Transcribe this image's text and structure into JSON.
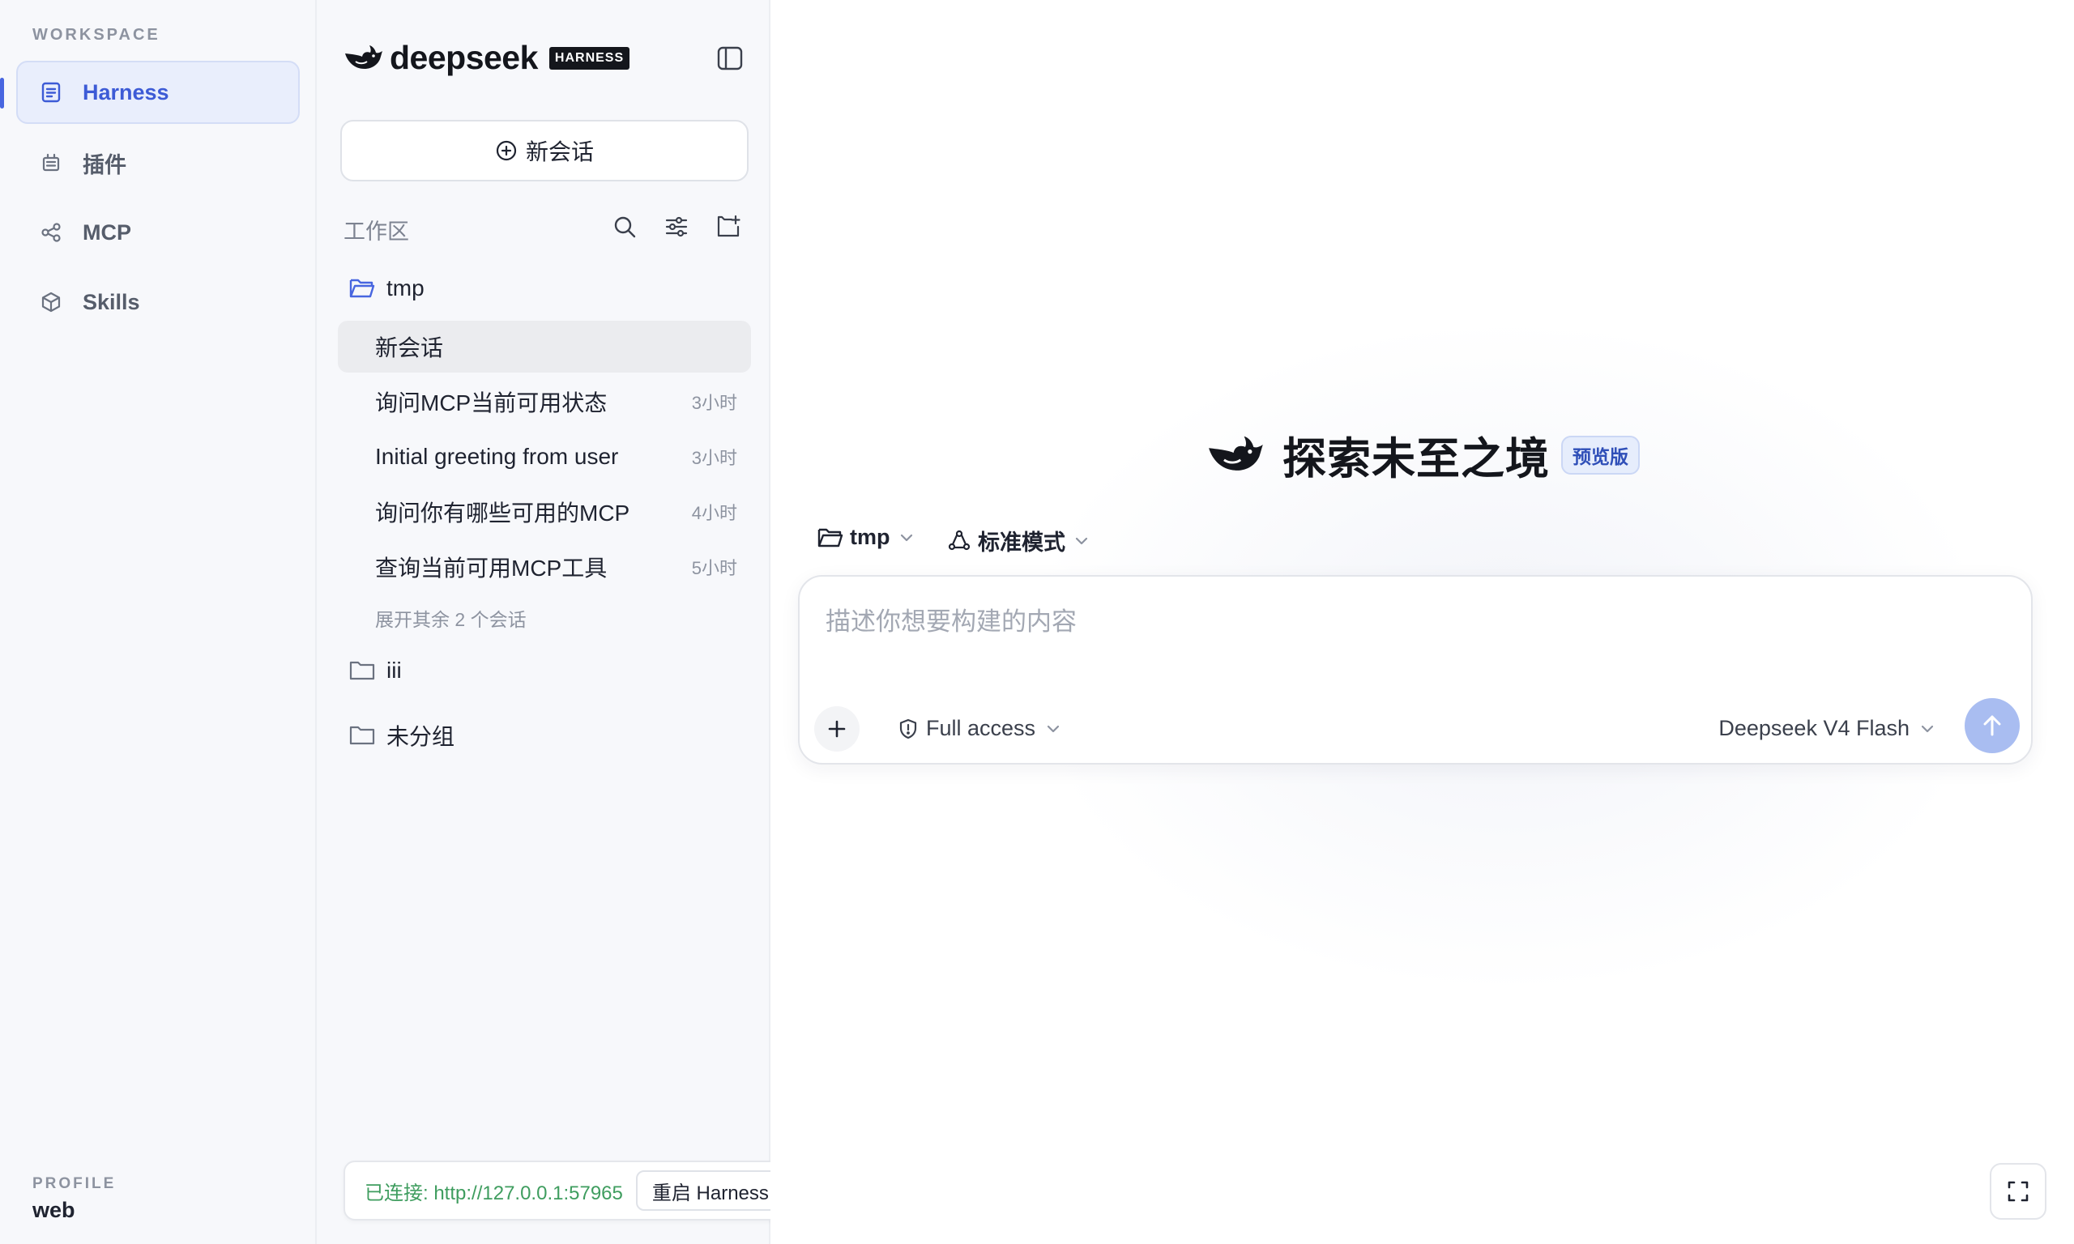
{
  "nav": {
    "heading": "WORKSPACE",
    "items": [
      {
        "label": "Harness",
        "icon": "document-list-icon",
        "active": true
      },
      {
        "label": "插件",
        "icon": "plugin-icon"
      },
      {
        "label": "MCP",
        "icon": "share-nodes-icon"
      },
      {
        "label": "Skills",
        "icon": "cube-icon"
      }
    ],
    "profile_label": "PROFILE",
    "profile_value": "web"
  },
  "sidebar": {
    "brand_word": "deepseek",
    "brand_badge": "HARNESS",
    "new_chat_label": "新会话",
    "workspace_label": "工作区",
    "folders": [
      {
        "name": "tmp",
        "open": true
      },
      {
        "name": "iii"
      },
      {
        "name": "未分组"
      }
    ],
    "conversations": [
      {
        "title": "新会话",
        "time": "",
        "active": true
      },
      {
        "title": "询问MCP当前可用状态",
        "time": "3小时"
      },
      {
        "title": "Initial greeting from user",
        "time": "3小时"
      },
      {
        "title": "询问你有哪些可用的MCP",
        "time": "4小时"
      },
      {
        "title": "查询当前可用MCP工具",
        "time": "5小时"
      }
    ],
    "expand_more": "展开其余 2 个会话",
    "status_text": "已连接: http://127.0.0.1:57965",
    "restart_label": "重启 Harness"
  },
  "main": {
    "hero_title": "探索未至之境",
    "hero_badge": "预览版",
    "folder_chip": "tmp",
    "mode_chip": "标准模式",
    "composer_placeholder": "描述你想要构建的内容",
    "access_label": "Full access",
    "model_label": "Deepseek V4 Flash"
  },
  "colors": {
    "accent": "#4866e0",
    "active_nav_bg": "#e9eefc",
    "send_button": "#a9bdf1",
    "status_green": "#3f9d5f"
  }
}
